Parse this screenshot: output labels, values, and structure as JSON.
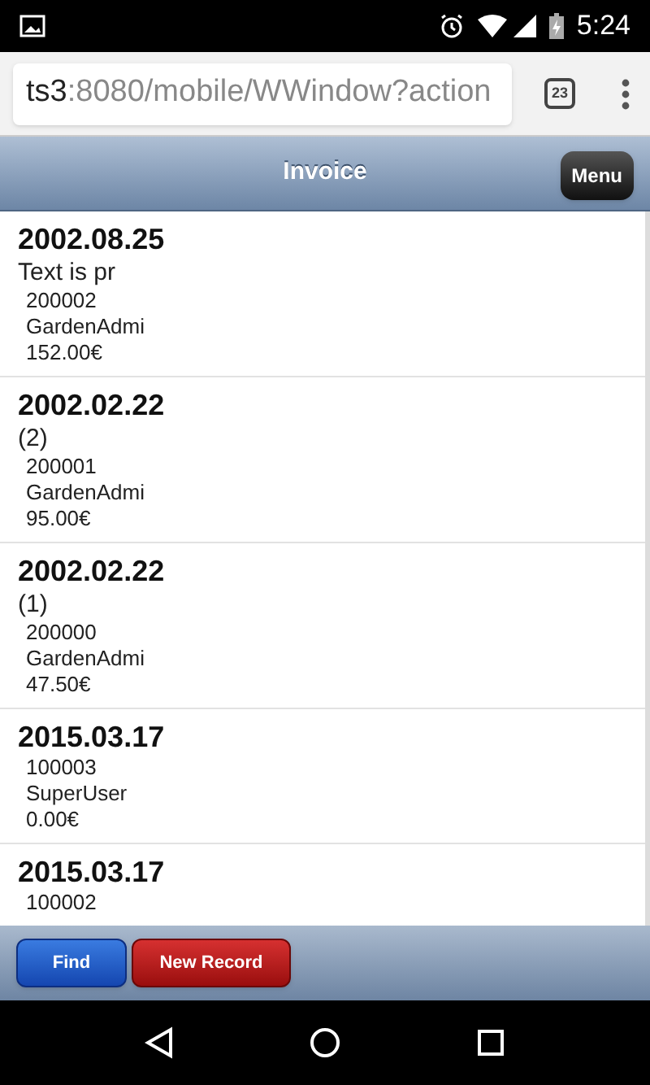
{
  "status_bar": {
    "time": "5:24"
  },
  "browser": {
    "url_host": "ts3",
    "url_rest": ":8080/mobile/WWindow?action",
    "tab_count": "23"
  },
  "header": {
    "title": "Invoice",
    "menu_button": "Menu"
  },
  "records": [
    {
      "date": "2002.08.25",
      "note": "Text is pr",
      "number": "200002",
      "user": "GardenAdmi",
      "amount": "152.00€"
    },
    {
      "date": "2002.02.22",
      "note": "(2)",
      "number": "200001",
      "user": "GardenAdmi",
      "amount": "95.00€"
    },
    {
      "date": "2002.02.22",
      "note": "(1)",
      "number": "200000",
      "user": "GardenAdmi",
      "amount": "47.50€"
    },
    {
      "date": "2015.03.17",
      "number": "100003",
      "user": "SuperUser",
      "amount": "0.00€"
    },
    {
      "date": "2015.03.17",
      "number": "100002"
    }
  ],
  "footer": {
    "buttons": [
      {
        "label": "Find",
        "kind": "primary"
      },
      {
        "label": "New Record",
        "kind": "danger"
      }
    ]
  }
}
